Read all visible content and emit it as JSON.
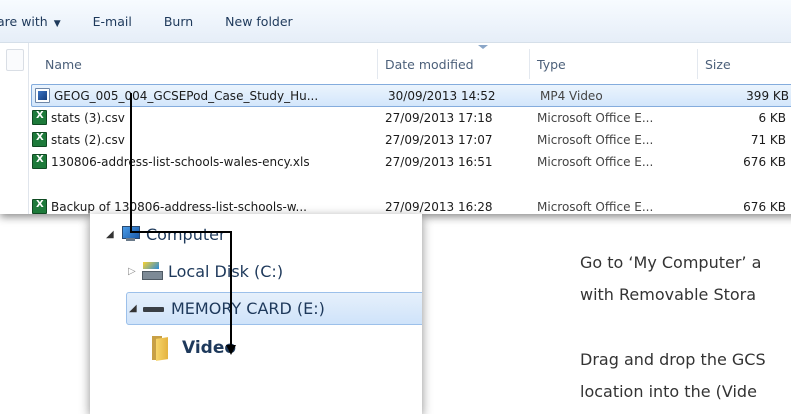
{
  "toolbar": {
    "share_label": "are with",
    "email_label": "E-mail",
    "burn_label": "Burn",
    "new_folder_label": "New folder"
  },
  "columns": {
    "name": "Name",
    "date": "Date modified",
    "type": "Type",
    "size": "Size"
  },
  "files": [
    {
      "name": "GEOG_005_004_GCSEPod_Case_Study_Hu...",
      "date": "30/09/2013 14:52",
      "type": "MP4 Video",
      "size": "399 KB",
      "icon": "mp4-video-icon"
    },
    {
      "name": "stats (3).csv",
      "date": "27/09/2013 17:18",
      "type": "Microsoft Office E...",
      "size": "6 KB",
      "icon": "excel-file-icon"
    },
    {
      "name": "stats (2).csv",
      "date": "27/09/2013 17:07",
      "type": "Microsoft Office E...",
      "size": "71 KB",
      "icon": "excel-file-icon"
    },
    {
      "name": "130806-address-list-schools-wales-ency.xls",
      "date": "27/09/2013 16:51",
      "type": "Microsoft Office E...",
      "size": "676 KB",
      "icon": "excel-file-icon"
    },
    {
      "name": "Backup of 130806-address-list-schools-w...",
      "date": "27/09/2013 16:28",
      "type": "Microsoft Office E...",
      "size": "676 KB",
      "icon": "excel-file-icon"
    }
  ],
  "nav": {
    "computer": "Computer",
    "local_disk": "Local Disk (C:)",
    "memory_card": "MEMORY CARD (E:)",
    "video": "Video"
  },
  "instructions": {
    "line1": "Go to ‘My Computer’ a",
    "line2": "with Removable Stora",
    "line3": "Drag and drop the GCS",
    "line4": "location into the (Vide"
  },
  "colors": {
    "selection_fill": "#d3e6fb",
    "selection_border": "#84acdd",
    "arrow": "#000000",
    "toolbar_text": "#1e395b"
  }
}
